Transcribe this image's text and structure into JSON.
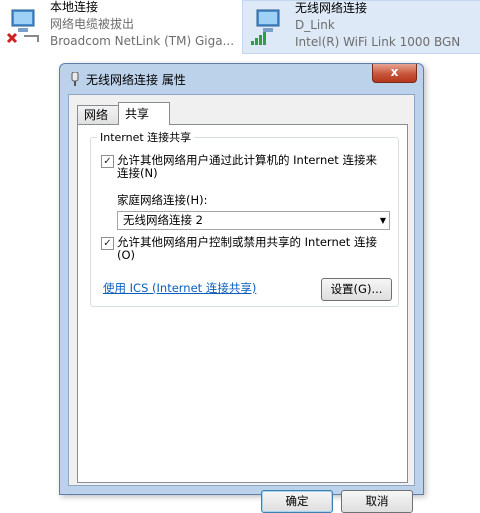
{
  "background": {
    "local": {
      "name": "本地连接",
      "status": "网络电缆被拔出",
      "device": "Broadcom NetLink (TM) Giga..."
    },
    "wireless": {
      "name": "无线网络连接",
      "ssid": "D_Link",
      "device": "Intel(R) WiFi Link 1000 BGN"
    }
  },
  "dialog": {
    "title": "无线网络连接 属性",
    "close": "x",
    "tabs": [
      "网络",
      "共享"
    ],
    "group_title": "Internet 连接共享",
    "allow_share": {
      "checked": true,
      "label": "允许其他网络用户通过此计算机的 Internet 连接来连接(N)"
    },
    "home_network_label": "家庭网络连接(H):",
    "home_network_value": "无线网络连接 2",
    "allow_control": {
      "checked": true,
      "label": "允许其他网络用户控制或禁用共享的 Internet 连接(O)"
    },
    "ics_link": "使用 ICS (Internet 连接共享)",
    "settings_button": "设置(G)...",
    "ok_button": "确定",
    "cancel_button": "取消"
  },
  "colors": {
    "title_bar": "#bcd2ea",
    "link": "#0a5ebd",
    "close": "#c7553a"
  }
}
